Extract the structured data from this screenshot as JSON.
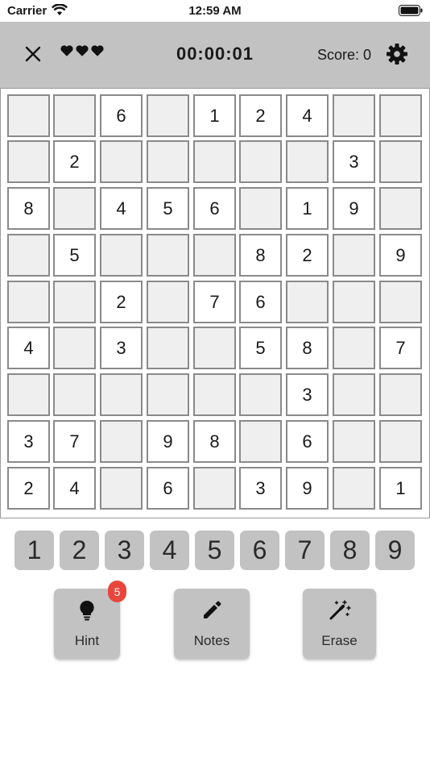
{
  "status_bar": {
    "carrier": "Carrier",
    "time": "12:59 AM"
  },
  "header": {
    "lives": 3,
    "timer": "00:00:01",
    "score_label": "Score: 0"
  },
  "board": {
    "rows": [
      [
        "",
        "",
        "6",
        "",
        "1",
        "2",
        "4",
        "",
        ""
      ],
      [
        "",
        "2",
        "",
        "",
        "",
        "",
        "",
        "3",
        ""
      ],
      [
        "8",
        "",
        "4",
        "5",
        "6",
        "",
        "1",
        "9",
        ""
      ],
      [
        "",
        "5",
        "",
        "",
        "",
        "8",
        "2",
        "",
        "9"
      ],
      [
        "",
        "",
        "2",
        "",
        "7",
        "6",
        "",
        "",
        ""
      ],
      [
        "4",
        "",
        "3",
        "",
        "",
        "5",
        "8",
        "",
        "7"
      ],
      [
        "",
        "",
        "",
        "",
        "",
        "",
        "3",
        "",
        ""
      ],
      [
        "3",
        "7",
        "",
        "9",
        "8",
        "",
        "6",
        "",
        ""
      ],
      [
        "2",
        "4",
        "",
        "6",
        "",
        "3",
        "9",
        "",
        "1"
      ]
    ]
  },
  "numpad": [
    "1",
    "2",
    "3",
    "4",
    "5",
    "6",
    "7",
    "8",
    "9"
  ],
  "tools": {
    "hint_label": "Hint",
    "hint_count": "5",
    "notes_label": "Notes",
    "erase_label": "Erase"
  },
  "colors": {
    "header_bg": "#c2c2c2",
    "empty_cell": "#efefef",
    "badge": "#e8453c"
  }
}
